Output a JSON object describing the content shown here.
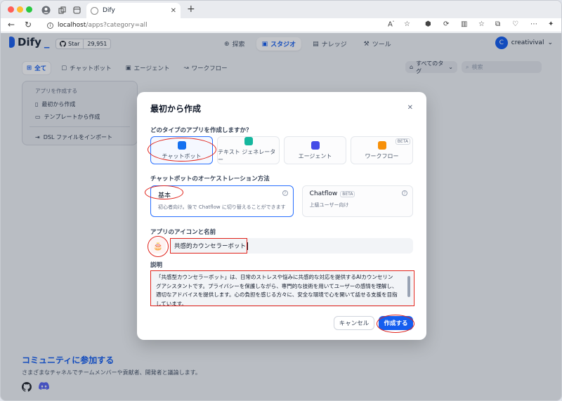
{
  "browser": {
    "tab_title": "Dify",
    "url_host": "localhost",
    "url_path": "/apps?category=all"
  },
  "header": {
    "logo": "Dify",
    "github_star": "Star",
    "github_count": "29,951",
    "nav": [
      {
        "label": "探索",
        "icon": "compass-icon"
      },
      {
        "label": "スタジオ",
        "icon": "robot-icon"
      },
      {
        "label": "ナレッジ",
        "icon": "book-icon"
      },
      {
        "label": "ツール",
        "icon": "tool-icon"
      }
    ],
    "user_initial": "C",
    "user_name": "creativival"
  },
  "filters": {
    "items": [
      "全て",
      "チャットボット",
      "エージェント",
      "ワークフロー"
    ],
    "tags": "すべてのタグ",
    "search_placeholder": "検索"
  },
  "create_card": {
    "caption": "アプリを作成する",
    "blank": "最初から作成",
    "template": "テンプレートから作成",
    "import": "DSL ファイルをインポート"
  },
  "community": {
    "title": "コミュニティに参加する",
    "subtitle": "さまざまなチャネルでチームメンバーや貢献者、開発者と議論します。"
  },
  "modal": {
    "title": "最初から作成",
    "type_question": "どのタイプのアプリを作成しますか？",
    "types": [
      {
        "label": "チャットボット",
        "color": "#1570ef"
      },
      {
        "label": "テキスト ジェネレーター",
        "color": "#15b79e"
      },
      {
        "label": "エージェント",
        "color": "#444ce7"
      },
      {
        "label": "ワークフロー",
        "color": "#f79009",
        "badge": "BETA"
      }
    ],
    "orch_label": "チャットボットのオーケストレーション方法",
    "orch_basic_title": "基本",
    "orch_basic_desc": "初心者向け。後で Chatflow に切り替えることができます",
    "orch_chatflow_title": "Chatflow",
    "orch_chatflow_badge": "BETA",
    "orch_chatflow_desc": "上級ユーザー向け",
    "icon_name_label": "アプリのアイコンと名前",
    "app_name": "共感的カウンセラーボット",
    "desc_label": "説明",
    "description": "「共感型カウンセラーボット」は、日常のストレスや悩みに共感的な対応を提供するAIカウンセリングアシスタントです。プライバシーを保護しながら、専門的な技術を用いてユーザーの感情を理解し、適切なアドバイスを提供します。心の負担を感じる方々に、安全な環境で心を開いて話せる支援を目指しています。",
    "cancel": "キャンセル",
    "create": "作成する"
  }
}
